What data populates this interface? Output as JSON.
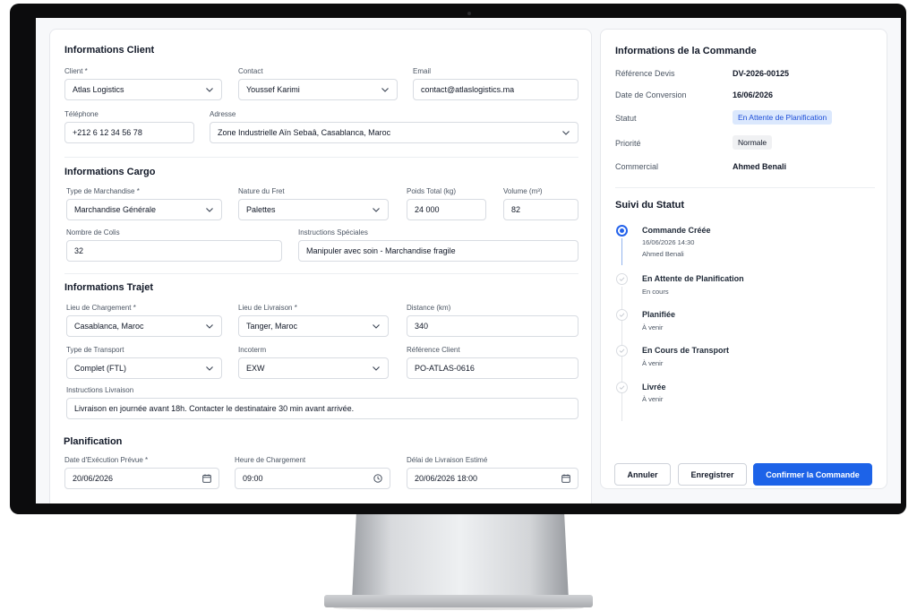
{
  "client": {
    "section_title": "Informations Client",
    "client_label": "Client *",
    "client_value": "Atlas Logistics",
    "contact_label": "Contact",
    "contact_value": "Youssef Karimi",
    "email_label": "Email",
    "email_value": "contact@atlaslogistics.ma",
    "phone_label": "Téléphone",
    "phone_value": "+212 6 12 34 56 78",
    "address_label": "Adresse",
    "address_value": "Zone Industrielle Aïn Sebaâ, Casablanca, Maroc"
  },
  "cargo": {
    "section_title": "Informations Cargo",
    "type_label": "Type de Marchandise *",
    "type_value": "Marchandise Générale",
    "nature_label": "Nature du Fret",
    "nature_value": "Palettes",
    "weight_label": "Poids Total (kg)",
    "weight_value": "24 000",
    "volume_label": "Volume (m³)",
    "volume_value": "82",
    "packages_label": "Nombre de Colis",
    "packages_value": "32",
    "instructions_label": "Instructions Spéciales",
    "instructions_value": "Manipuler avec soin - Marchandise fragile"
  },
  "trajet": {
    "section_title": "Informations Trajet",
    "loading_label": "Lieu de Chargement *",
    "loading_value": "Casablanca, Maroc",
    "delivery_label": "Lieu de Livraison *",
    "delivery_value": "Tanger, Maroc",
    "distance_label": "Distance (km)",
    "distance_value": "340",
    "transport_label": "Type de Transport",
    "transport_value": "Complet (FTL)",
    "incoterm_label": "Incoterm",
    "incoterm_value": "EXW",
    "reference_label": "Référence Client",
    "reference_value": "PO-ATLAS-0616",
    "delivery_instructions_label": "Instructions Livraison",
    "delivery_instructions_value": "Livraison en journée avant 18h. Contacter le destinataire 30 min avant arrivée."
  },
  "planification": {
    "section_title": "Planification",
    "exec_date_label": "Date d'Exécution Prévue *",
    "exec_date_value": "20/06/2026",
    "loading_time_label": "Heure de Chargement",
    "loading_time_value": "09:00",
    "delivery_delay_label": "Délai de Livraison Estimé",
    "delivery_delay_value": "20/06/2026 18:00"
  },
  "order": {
    "section_title": "Informations de la Commande",
    "quote_ref_label": "Référence Devis",
    "quote_ref_value": "DV-2026-00125",
    "conversion_date_label": "Date de Conversion",
    "conversion_date_value": "16/06/2026",
    "status_label": "Statut",
    "status_value": "En Attente de Planification",
    "priority_label": "Priorité",
    "priority_value": "Normale",
    "sales_label": "Commercial",
    "sales_value": "Ahmed Benali"
  },
  "status_tracking": {
    "section_title": "Suivi du Statut",
    "steps": [
      {
        "title": "Commande Créée",
        "line1": "16/06/2026 14:30",
        "line2": "Ahmed Benali"
      },
      {
        "title": "En Attente de Planification",
        "line1": "En cours"
      },
      {
        "title": "Planifiée",
        "line1": "À venir"
      },
      {
        "title": "En Cours de Transport",
        "line1": "À venir"
      },
      {
        "title": "Livrée",
        "line1": "À venir"
      }
    ]
  },
  "actions": {
    "cancel_label": "Annuler",
    "save_label": "Enregistrer",
    "confirm_label": "Confirmer la Commande"
  },
  "colors": {
    "accent": "#1d63e8",
    "badge_blue_bg": "#dbe8fd",
    "badge_blue_text": "#1d4ed8"
  }
}
